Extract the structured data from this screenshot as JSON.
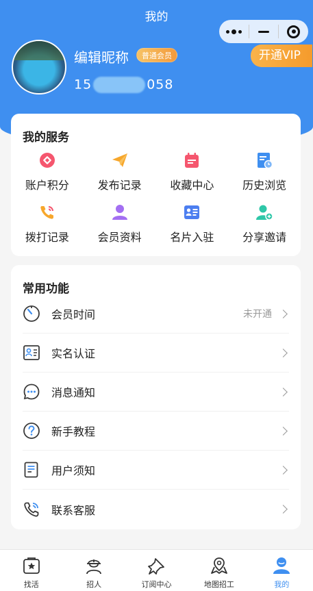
{
  "header": {
    "title": "我的",
    "nickname": "编辑昵称",
    "member_badge": "普通会员",
    "phone_prefix": "15",
    "phone_suffix": "058",
    "vip_button": "开通VIP"
  },
  "services": {
    "title": "我的服务",
    "items": [
      {
        "label": "账户积分",
        "icon": "coin-icon"
      },
      {
        "label": "发布记录",
        "icon": "paper-plane-icon"
      },
      {
        "label": "收藏中心",
        "icon": "calendar-icon"
      },
      {
        "label": "历史浏览",
        "icon": "history-doc-icon"
      },
      {
        "label": "拨打记录",
        "icon": "phone-call-icon"
      },
      {
        "label": "会员资料",
        "icon": "user-icon"
      },
      {
        "label": "名片入驻",
        "icon": "business-card-icon"
      },
      {
        "label": "分享邀请",
        "icon": "add-user-icon"
      }
    ]
  },
  "features": {
    "title": "常用功能",
    "items": [
      {
        "label": "会员时间",
        "value": "未开通",
        "icon": "timer-icon"
      },
      {
        "label": "实名认证",
        "value": "",
        "icon": "id-card-icon"
      },
      {
        "label": "消息通知",
        "value": "",
        "icon": "message-icon"
      },
      {
        "label": "新手教程",
        "value": "",
        "icon": "help-icon"
      },
      {
        "label": "用户须知",
        "value": "",
        "icon": "document-icon"
      },
      {
        "label": "联系客服",
        "value": "",
        "icon": "phone-icon"
      }
    ]
  },
  "tabbar": {
    "items": [
      {
        "label": "找活",
        "icon": "star-box-icon"
      },
      {
        "label": "招人",
        "icon": "worker-icon"
      },
      {
        "label": "订阅中心",
        "icon": "pin-icon"
      },
      {
        "label": "地图招工",
        "icon": "map-icon"
      },
      {
        "label": "我的",
        "icon": "profile-icon"
      }
    ],
    "active_index": 4
  },
  "colors": {
    "primary": "#3f8ff0",
    "vip": "#f59b2c"
  }
}
